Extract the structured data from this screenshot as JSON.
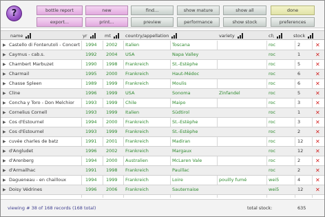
{
  "toolbar": {
    "help_label": "?",
    "bottle_report": "bottle report",
    "new": "new",
    "find": "find...",
    "show_mature": "show mature",
    "show_all": "show all",
    "done": "done",
    "export": "export...",
    "print": "print...",
    "preview": "preview",
    "performance": "performance",
    "show_stock": "show stock",
    "preferences": "preferences"
  },
  "columns": {
    "name": "name",
    "yr": "yr",
    "mt": "mt",
    "country": "country/appellation",
    "variety": "variety",
    "cl": "cl\\",
    "stock": "stock"
  },
  "rows": [
    {
      "name": "Castello di Fonterutoli - Concerto",
      "yr": "1994",
      "mt": "2002",
      "country": "Italien",
      "region": "Toscana",
      "variety": "",
      "cl": "roc",
      "stock": "2"
    },
    {
      "name": "Caymus - cab.s.",
      "yr": "1992",
      "mt": "2004",
      "country": "USA",
      "region": "Napa Valley",
      "variety": "",
      "cl": "roc",
      "stock": "1"
    },
    {
      "name": "Chambert Marbuzet",
      "yr": "1990",
      "mt": "1998",
      "country": "Frankreich",
      "region": "St.-Estèphe",
      "variety": "",
      "cl": "roc",
      "stock": "5"
    },
    {
      "name": "Charmail",
      "yr": "1995",
      "mt": "2000",
      "country": "Frankreich",
      "region": "Haut-Médoc",
      "variety": "",
      "cl": "roc",
      "stock": "6"
    },
    {
      "name": "Chasse Spleen",
      "yr": "1989",
      "mt": "1999",
      "country": "Frankreich",
      "region": "Moulis",
      "variety": "",
      "cl": "roc",
      "stock": "6"
    },
    {
      "name": "Cline",
      "yr": "1996",
      "mt": "1999",
      "country": "USA",
      "region": "Sonoma",
      "variety": "Zinfandel",
      "cl": "roc",
      "stock": "5"
    },
    {
      "name": "Concha y Toro - Don Melchior",
      "yr": "1993",
      "mt": "1999",
      "country": "Chile",
      "region": "Maipo",
      "variety": "",
      "cl": "roc",
      "stock": "3"
    },
    {
      "name": "Cornelius Cornell",
      "yr": "1993",
      "mt": "1999",
      "country": "Italien",
      "region": "Südtirol",
      "variety": "",
      "cl": "roc",
      "stock": "1"
    },
    {
      "name": "Cos d'Estournel",
      "yr": "1994",
      "mt": "2000",
      "country": "Frankreich",
      "region": "St.-Estèphe",
      "variety": "",
      "cl": "roc",
      "stock": "3"
    },
    {
      "name": "Cos d'Estournel",
      "yr": "1993",
      "mt": "1999",
      "country": "Frankreich",
      "region": "St.-Estèphe",
      "variety": "",
      "cl": "roc",
      "stock": "2"
    },
    {
      "name": "cuvée charles de batz",
      "yr": "1991",
      "mt": "2001",
      "country": "Frankreich",
      "region": "Madiran",
      "variety": "",
      "cl": "roc",
      "stock": "12"
    },
    {
      "name": "d'Angludet",
      "yr": "1996",
      "mt": "2002",
      "country": "Frankreich",
      "region": "Margaux",
      "variety": "",
      "cl": "roc",
      "stock": "12"
    },
    {
      "name": "d'Arenberg",
      "yr": "1994",
      "mt": "2000",
      "country": "Australien",
      "region": "McLaren Vale",
      "variety": "",
      "cl": "roc",
      "stock": "2"
    },
    {
      "name": "d'Armailhac",
      "yr": "1991",
      "mt": "1998",
      "country": "Frankreich",
      "region": "Pauillac",
      "variety": "",
      "cl": "roc",
      "stock": "2"
    },
    {
      "name": "Dagueneau - en chailloux",
      "yr": "1994",
      "mt": "1999",
      "country": "Frankreich",
      "region": "Loire",
      "variety": "pouilly fumé",
      "cl": "wei5",
      "stock": "4"
    },
    {
      "name": "Doisy Védrines",
      "yr": "1996",
      "mt": "2006",
      "country": "Frankreich",
      "region": "Sauternaise",
      "variety": "",
      "cl": "wei5",
      "stock": "12"
    }
  ],
  "delete_glyph": "✕",
  "arrow_glyph": "▶",
  "footer": {
    "records": "viewing # 38 of 168 records (168 total)",
    "stock_label": "total stock:",
    "stock_value": "635"
  },
  "colors": {
    "text_green": "#2f8a2f",
    "delete_red": "#d21e1e",
    "pink_button": "#e2a9df",
    "grey_button": "#c8d0cc",
    "done_button": "#e1e3a8",
    "help_button": "#9a55c8"
  }
}
